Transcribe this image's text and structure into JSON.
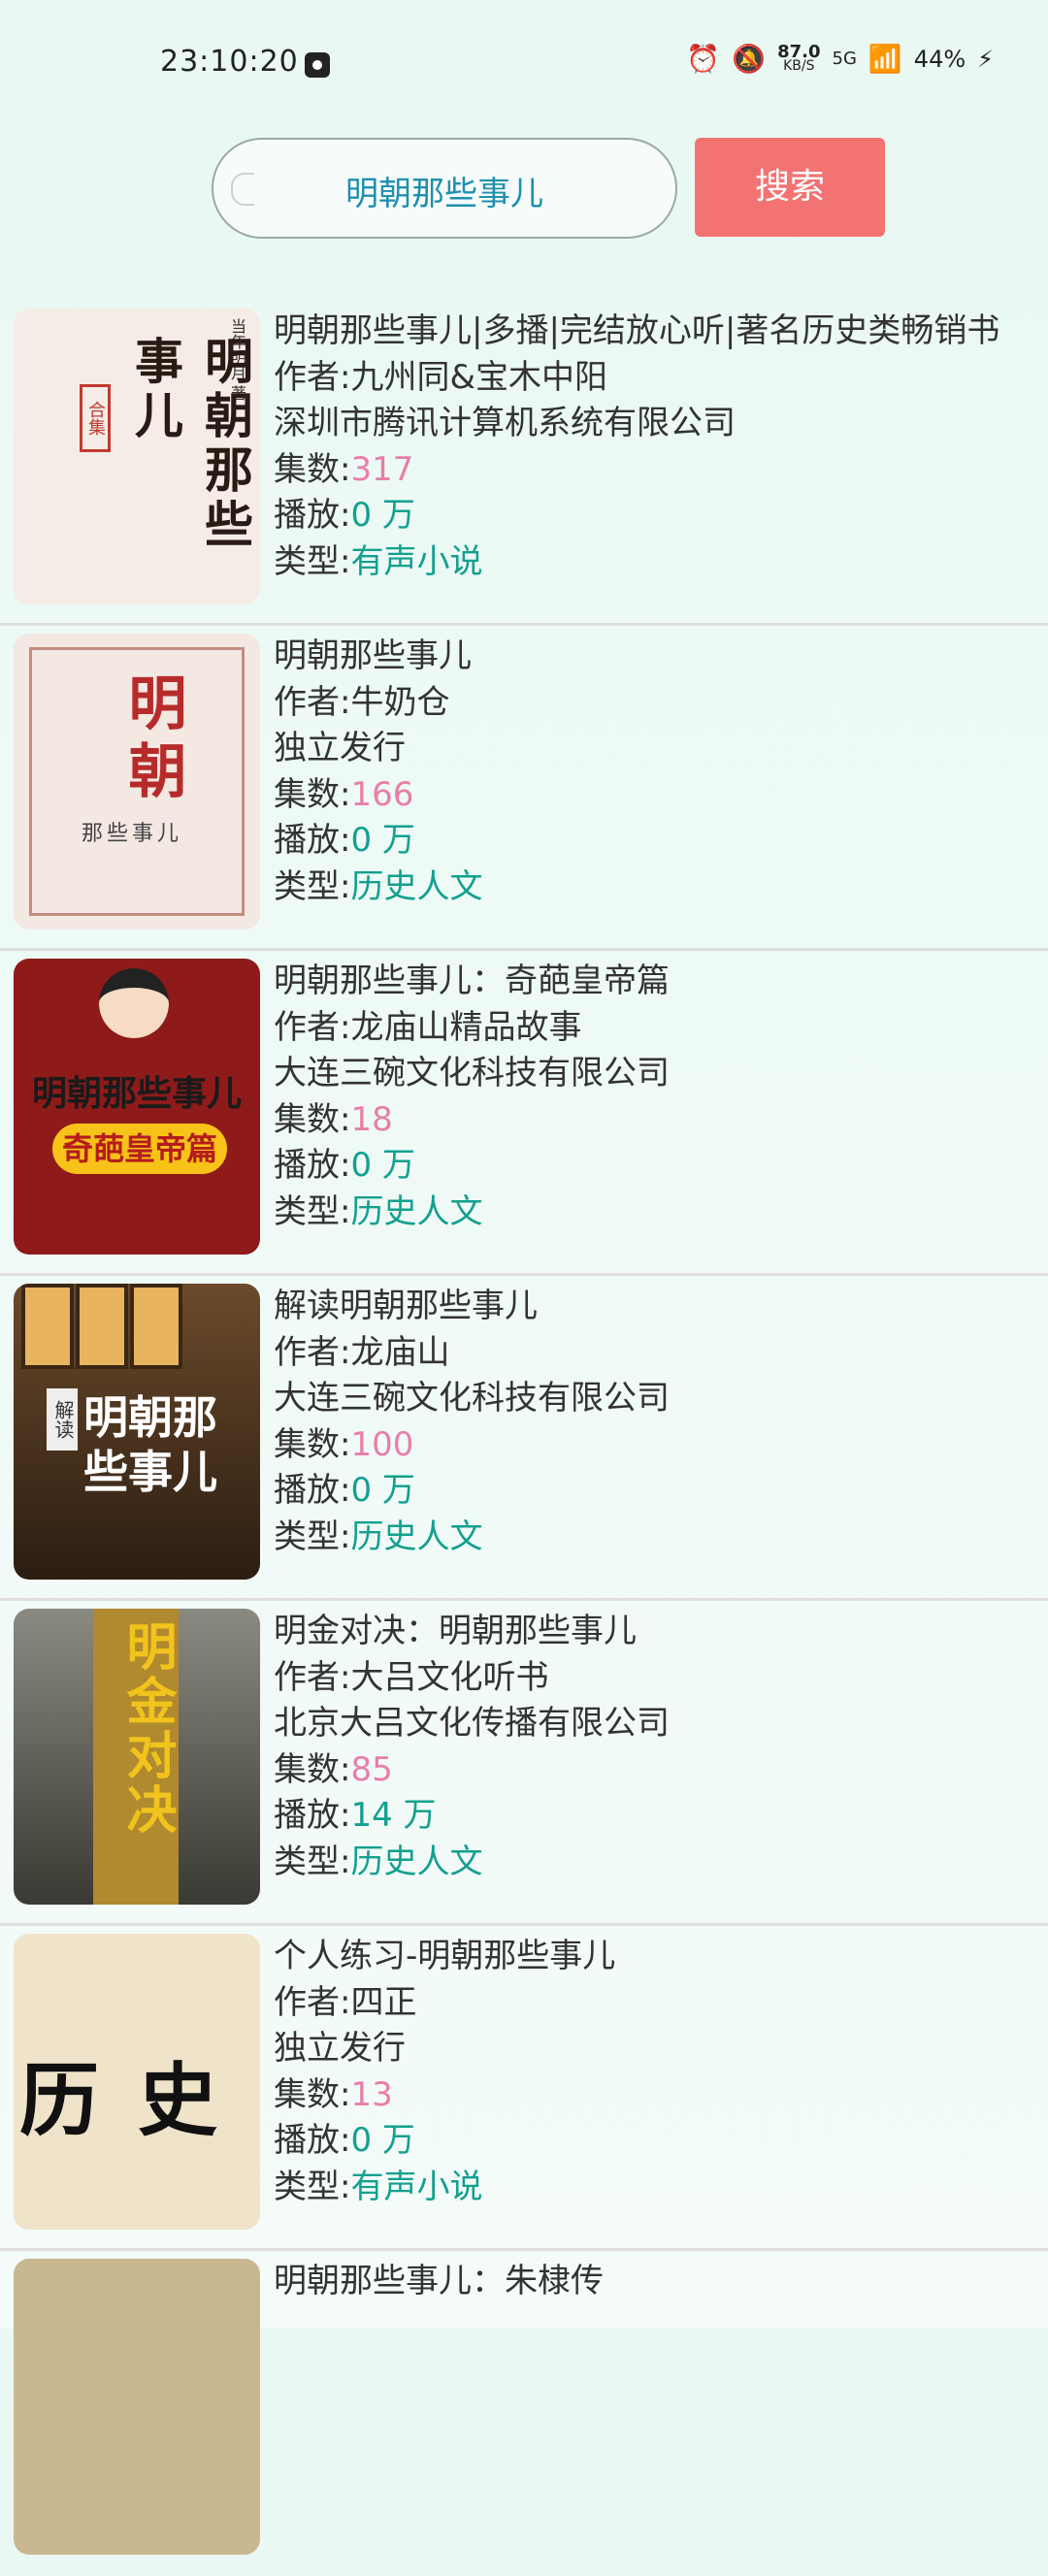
{
  "status_bar": {
    "time": "23:10:20",
    "net_speed_value": "87.0",
    "net_speed_unit": "KB/S",
    "network": "5G",
    "battery": "44%"
  },
  "search": {
    "query": "明朝那些事儿",
    "button_label": "搜索"
  },
  "labels": {
    "author": "作者:",
    "episodes": "集数:",
    "plays": "播放:",
    "genre": "类型:"
  },
  "results": [
    {
      "title": "明朝那些事儿|多播|完结放心听|著名历史类畅销书",
      "author": "九州同&宝木中阳",
      "publisher": "深圳市腾讯计算机系统有限公司",
      "episodes": "317",
      "plays": "0 万",
      "genre": "有声小说",
      "cover_text": "明朝那些事儿",
      "cover_seal": "合集",
      "cover_small": "当年明月 著"
    },
    {
      "title": "明朝那些事儿",
      "author": "牛奶仓",
      "publisher": "独立发行",
      "episodes": "166",
      "plays": "0 万",
      "genre": "历史人文",
      "cover_text": "明朝",
      "cover_sub": "那些事儿"
    },
    {
      "title": "明朝那些事儿：奇葩皇帝篇",
      "author": "龙庙山精品故事",
      "publisher": "大连三碗文化科技有限公司",
      "episodes": "18",
      "plays": "0 万",
      "genre": "历史人文",
      "cover_text": "明朝那些事儿",
      "cover_sub": "奇葩皇帝篇"
    },
    {
      "title": "解读明朝那些事儿",
      "author": "龙庙山",
      "publisher": "大连三碗文化科技有限公司",
      "episodes": "100",
      "plays": "0 万",
      "genre": "历史人文",
      "cover_tag": "解读",
      "cover_text": "明朝那些事儿"
    },
    {
      "title": "明金对决：明朝那些事儿",
      "author": "大吕文化听书",
      "publisher": "北京大吕文化传播有限公司",
      "episodes": "85",
      "plays": "14 万",
      "genre": "历史人文",
      "cover_text": "明金对决"
    },
    {
      "title": "个人练习-明朝那些事儿",
      "author": "四正",
      "publisher": "独立发行",
      "episodes": "13",
      "plays": "0 万",
      "genre": "有声小说",
      "cover_text": "历史"
    },
    {
      "title": "明朝那些事儿：朱棣传"
    }
  ]
}
